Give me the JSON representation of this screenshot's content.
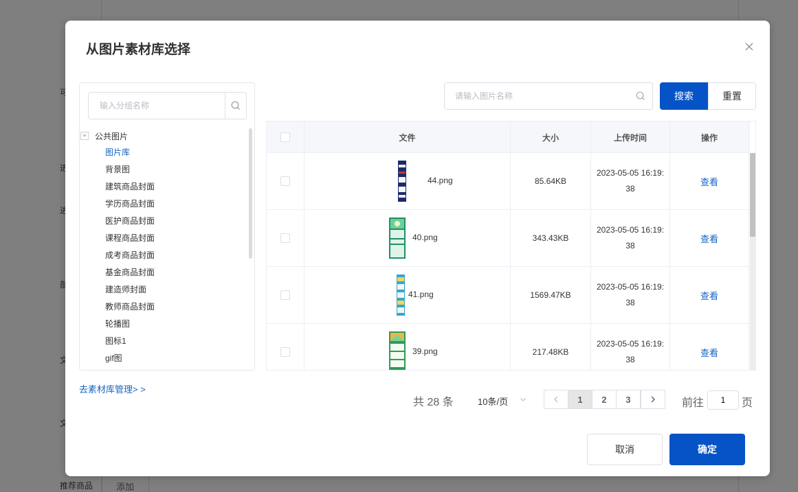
{
  "background": {
    "side_labels": [
      "可",
      "进",
      "进",
      "部",
      "文",
      "文"
    ],
    "bottom_label": "推荐商品",
    "bottom_add": "添加"
  },
  "dialog": {
    "title": "从图片素材库选择",
    "group_search": {
      "placeholder": "输入分组名称"
    },
    "tree": {
      "root": "公共图片",
      "items": [
        "图片库",
        "背景图",
        "建筑商品封面",
        "学历商品封面",
        "医护商品封面",
        "课程商品封面",
        "成考商品封面",
        "基金商品封面",
        "建造师封面",
        "教师商品封面",
        "轮播图",
        "图标1",
        "gif图"
      ],
      "active_index": 0
    },
    "goto_library": "去素材库管理> >",
    "name_search": {
      "placeholder": "请输入图片名称"
    },
    "search_button": "搜索",
    "reset_button": "重置",
    "table": {
      "columns": [
        "文件",
        "大小",
        "上传时间",
        "操作"
      ],
      "rows": [
        {
          "file": "44.png",
          "size": "85.64KB",
          "time": "2023-05-05 16:19:38",
          "action": "查看"
        },
        {
          "file": "40.png",
          "size": "343.43KB",
          "time": "2023-05-05 16:19:38",
          "action": "查看"
        },
        {
          "file": "41.png",
          "size": "1569.47KB",
          "time": "2023-05-05 16:19:38",
          "action": "查看"
        },
        {
          "file": "39.png",
          "size": "217.48KB",
          "time": "2023-05-05 16:19:38",
          "action": "查看"
        }
      ]
    },
    "pagination": {
      "total_text": "共 28 条",
      "page_size": "10条/页",
      "pages": [
        "1",
        "2",
        "3"
      ],
      "current_page": "1",
      "goto_label": "前往",
      "goto_value": "1",
      "goto_suffix": "页"
    },
    "cancel_button": "取消",
    "confirm_button": "确定"
  },
  "colors": {
    "primary": "#0553c7",
    "link": "#1565c0",
    "overlay": "#808080"
  }
}
